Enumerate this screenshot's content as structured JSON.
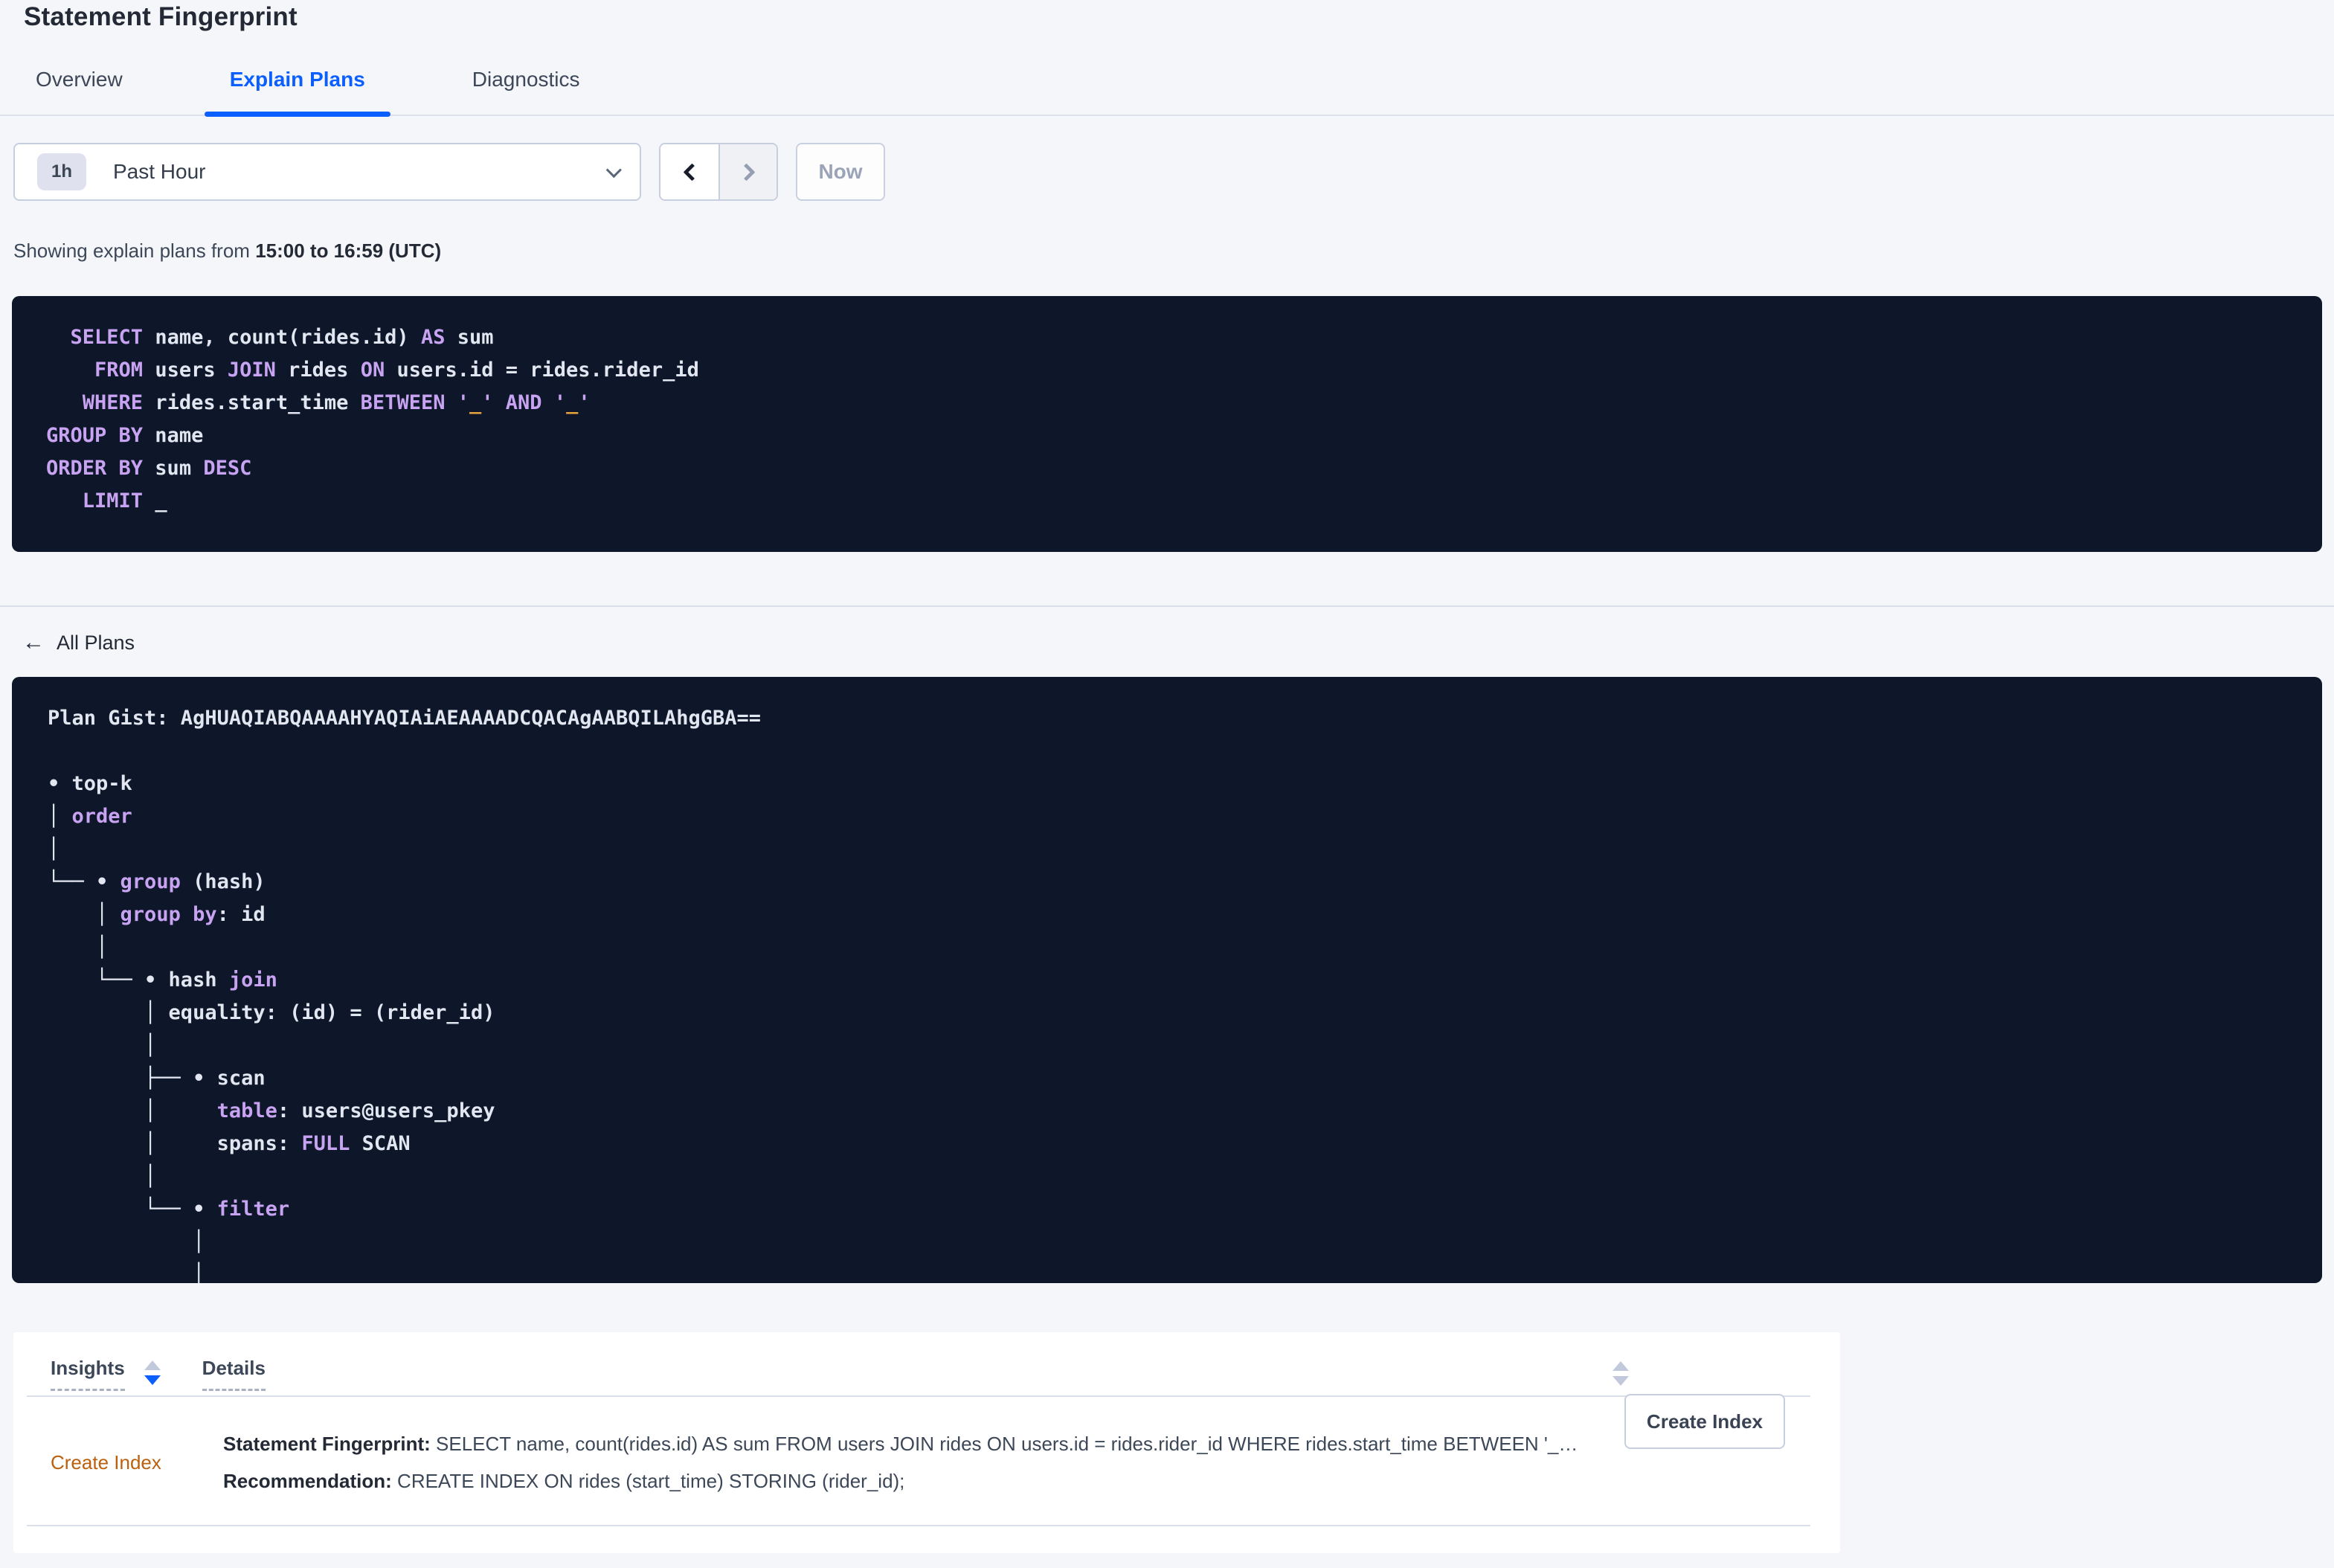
{
  "colors": {
    "accent-blue": "#0b5fff",
    "page-bg": "#f4f6fa",
    "code-bg": "#0d1729",
    "code-plain": "#e2e6f0",
    "code-keyword": "#c8a3f2",
    "code-literal": "#e8a33d",
    "text-primary": "#242a35",
    "text-secondary": "#3c4758",
    "border-grey": "#c7cedd",
    "divider": "#dbdfe9",
    "link-orange": "#bb600e",
    "disabled-grey": "#9aa3b8",
    "sort-inactive": "#c2c9dd"
  },
  "page": {
    "title": "Statement Fingerprint"
  },
  "tabs": {
    "overview": "Overview",
    "explain_plans": "Explain Plans",
    "diagnostics": "Diagnostics"
  },
  "time_picker": {
    "badge": "1h",
    "selected": "Past Hour",
    "now": "Now"
  },
  "showing": {
    "prefix": "Showing explain plans from ",
    "range": "15:00 to 16:59 (UTC)"
  },
  "sql": {
    "lines": [
      [
        [
          "  ",
          "p"
        ],
        [
          "SELECT",
          "k"
        ],
        [
          " name, count(rides.id) ",
          "p"
        ],
        [
          "AS",
          "k"
        ],
        [
          " sum",
          "p"
        ]
      ],
      [
        [
          "    ",
          "p"
        ],
        [
          "FROM",
          "k"
        ],
        [
          " users ",
          "p"
        ],
        [
          "JOIN",
          "k"
        ],
        [
          " rides ",
          "p"
        ],
        [
          "ON",
          "k"
        ],
        [
          " users.id = rides.rider_id",
          "p"
        ]
      ],
      [
        [
          "   ",
          "p"
        ],
        [
          "WHERE",
          "k"
        ],
        [
          " rides.start_time ",
          "p"
        ],
        [
          "BETWEEN",
          "k"
        ],
        [
          " ",
          "p"
        ],
        [
          "'",
          "k"
        ],
        [
          "_",
          "o"
        ],
        [
          "'",
          "k"
        ],
        [
          " ",
          "p"
        ],
        [
          "AND",
          "k"
        ],
        [
          " ",
          "p"
        ],
        [
          "'",
          "k"
        ],
        [
          "_",
          "o"
        ],
        [
          "'",
          "k"
        ]
      ],
      [
        [
          "GROUP BY",
          "k"
        ],
        [
          " name",
          "p"
        ]
      ],
      [
        [
          "ORDER BY",
          "k"
        ],
        [
          " sum ",
          "p"
        ],
        [
          "DESC",
          "k"
        ]
      ],
      [
        [
          "   ",
          "p"
        ],
        [
          "LIMIT",
          "k"
        ],
        [
          " _",
          "p"
        ]
      ]
    ]
  },
  "all_plans": {
    "label": "All Plans"
  },
  "plan": {
    "lines": [
      [
        [
          "Plan Gist: AgHUAQIABQAAAAHYAQIAiAEAAAADCQACAgAABQILAhgGBA==",
          "b"
        ]
      ],
      [],
      [
        [
          "• top-k",
          "p"
        ]
      ],
      [
        [
          "│ ",
          "p"
        ],
        [
          "order",
          "k"
        ]
      ],
      [
        [
          "│",
          "p"
        ]
      ],
      [
        [
          "└── • ",
          "p"
        ],
        [
          "group",
          "k"
        ],
        [
          " (hash)",
          "p"
        ]
      ],
      [
        [
          "    │ ",
          "p"
        ],
        [
          "group by",
          "k"
        ],
        [
          ": id",
          "p"
        ]
      ],
      [
        [
          "    │",
          "p"
        ]
      ],
      [
        [
          "    └── • hash ",
          "p"
        ],
        [
          "join",
          "k"
        ]
      ],
      [
        [
          "        │ equality: (id) = (rider_id)",
          "p"
        ]
      ],
      [
        [
          "        │",
          "p"
        ]
      ],
      [
        [
          "        ├── • scan",
          "p"
        ]
      ],
      [
        [
          "        │     ",
          "p"
        ],
        [
          "table",
          "k"
        ],
        [
          ": users@users_pkey",
          "p"
        ]
      ],
      [
        [
          "        │     spans: ",
          "p"
        ],
        [
          "FULL",
          "k"
        ],
        [
          " SCAN",
          "p"
        ]
      ],
      [
        [
          "        │",
          "p"
        ]
      ],
      [
        [
          "        └── • ",
          "p"
        ],
        [
          "filter",
          "k"
        ]
      ],
      [
        [
          "            │",
          "p"
        ]
      ],
      [
        [
          "            │",
          "p"
        ]
      ]
    ]
  },
  "insights_table": {
    "headers": {
      "insights": "Insights",
      "details": "Details"
    },
    "row": {
      "insight": "Create Index",
      "fingerprint_label": "Statement Fingerprint:",
      "fingerprint_text": " SELECT name, count(rides.id) AS sum FROM users JOIN rides ON users.id = rides.rider_id WHERE rides.start_time BETWEEN '_…",
      "recommendation_label": "Recommendation:",
      "recommendation_text": " CREATE INDEX ON rides (start_time) STORING (rider_id);",
      "action": "Create Index"
    }
  }
}
